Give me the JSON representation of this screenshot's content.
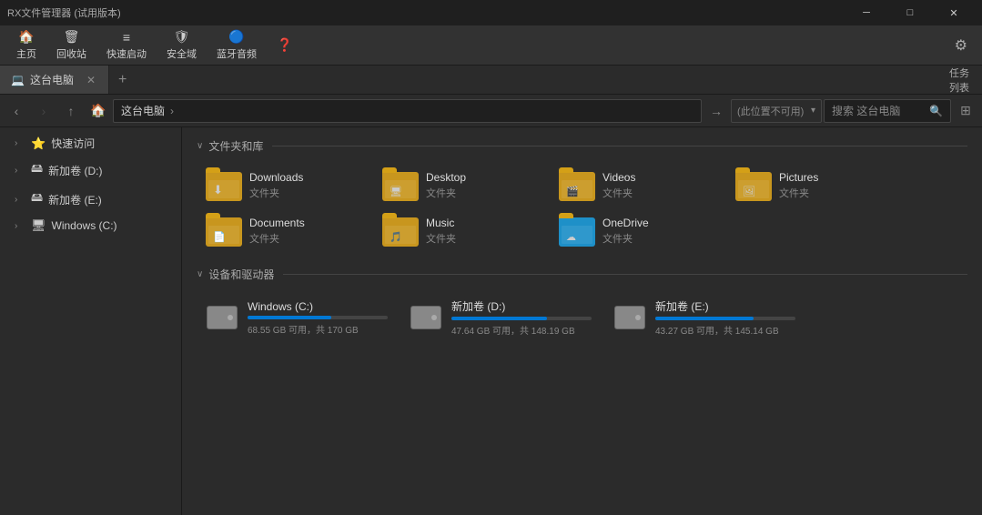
{
  "window": {
    "title": "RX文件管理器 (试用版本)",
    "controls": [
      "minimize",
      "maximize",
      "close"
    ]
  },
  "ribbon": {
    "tabs": [
      {
        "id": "home",
        "label": "主页",
        "icon": "🏠"
      },
      {
        "id": "recycle",
        "label": "回收站",
        "icon": "🗑"
      },
      {
        "id": "quicklaunch",
        "label": "快速启动",
        "icon": "📋"
      },
      {
        "id": "safezone",
        "label": "安全域",
        "icon": "🛡"
      },
      {
        "id": "bluetooth",
        "label": "蓝牙音频",
        "icon": "🔵"
      },
      {
        "id": "help",
        "label": "?",
        "icon": "?"
      }
    ],
    "settings_icon": "⚙"
  },
  "tab_bar": {
    "tabs": [
      {
        "id": "thispc",
        "label": "这台电脑",
        "icon": "💻",
        "active": true
      }
    ],
    "new_tab_label": "+",
    "right_btn": "任务列表"
  },
  "address_bar": {
    "back_disabled": false,
    "forward_disabled": true,
    "up_disabled": false,
    "home_icon": "🏠",
    "path": "这台电脑",
    "path_arrow": "›",
    "location_placeholder": "(此位置不可用)",
    "search_placeholder": "搜索 这台电脑"
  },
  "sidebar": {
    "items": [
      {
        "id": "quickaccess",
        "label": "快速访问",
        "expand": true,
        "icon": "⭐"
      },
      {
        "id": "newd",
        "label": "新加卷 (D:)",
        "expand": true,
        "icon": "💾"
      },
      {
        "id": "newe",
        "label": "新加卷 (E:)",
        "expand": true,
        "icon": "💾"
      },
      {
        "id": "windowsc",
        "label": "Windows (C:)",
        "expand": true,
        "icon": "🖥"
      }
    ]
  },
  "content": {
    "folders_section_label": "文件夹和库",
    "drives_section_label": "设备和驱动器",
    "folders": [
      {
        "id": "downloads",
        "name": "Downloads",
        "type": "文件夹",
        "icon_color": "#c8961e",
        "overlay": "⬇"
      },
      {
        "id": "desktop",
        "name": "Desktop",
        "type": "文件夹",
        "icon_color": "#c8961e",
        "overlay": "🖥"
      },
      {
        "id": "videos",
        "name": "Videos",
        "type": "文件夹",
        "icon_color": "#c8961e",
        "overlay": "🎬"
      },
      {
        "id": "pictures",
        "name": "Pictures",
        "type": "文件夹",
        "icon_color": "#c8961e",
        "overlay": "🖼"
      },
      {
        "id": "documents",
        "name": "Documents",
        "type": "文件夹",
        "icon_color": "#c8961e",
        "overlay": "📄"
      },
      {
        "id": "music",
        "name": "Music",
        "type": "文件夹",
        "icon_color": "#c8961e",
        "overlay": "🎵"
      },
      {
        "id": "onedrive",
        "name": "OneDrive",
        "type": "文件夹",
        "icon_color": "#1e90c8",
        "overlay": "☁"
      }
    ],
    "drives": [
      {
        "id": "windowsc",
        "name": "Windows (C:)",
        "free": "68.55 GB 可用，共 170 GB",
        "free_bytes": 68.55,
        "total_bytes": 170,
        "pct_used": 60
      },
      {
        "id": "newd",
        "name": "新加卷 (D:)",
        "free": "47.64 GB 可用，共 148.19 GB",
        "free_bytes": 47.64,
        "total_bytes": 148.19,
        "pct_used": 68
      },
      {
        "id": "newe",
        "name": "新加卷 (E:)",
        "free": "43.27 GB 可用，共 145.14 GB",
        "free_bytes": 43.27,
        "total_bytes": 145.14,
        "pct_used": 70
      }
    ]
  }
}
